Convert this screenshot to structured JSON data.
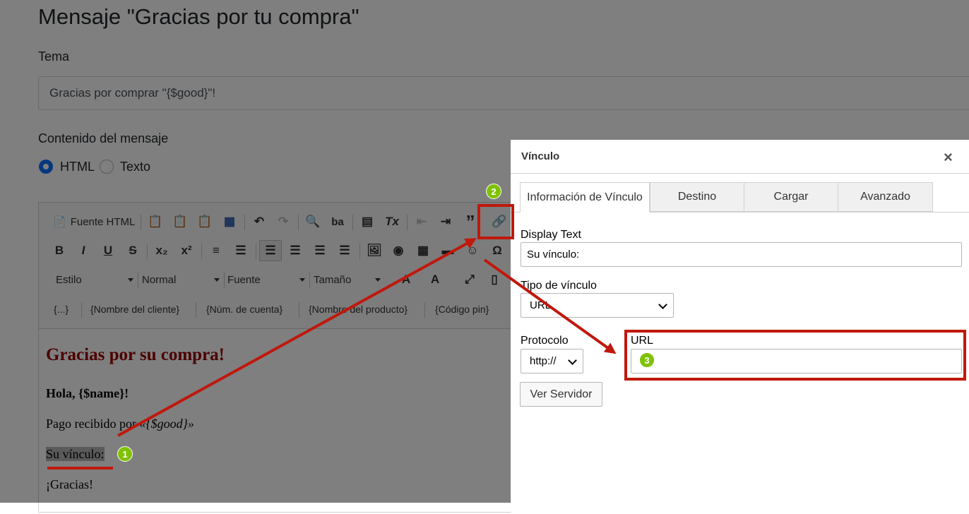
{
  "page": {
    "title": "Mensaje \"Gracias por tu compra\"",
    "subject_label": "Tema",
    "subject_value": "Gracias por comprar \"{$good}\"!",
    "content_label": "Contenido del mensaje",
    "format_options": [
      "HTML",
      "Texto"
    ],
    "format_selected": "HTML"
  },
  "toolbar": {
    "source_label": "Fuente HTML",
    "style_combo": "Estilo",
    "format_combo": "Normal",
    "font_combo": "Fuente",
    "size_combo": "Tamaño",
    "placeholders": [
      "{...}",
      "{Nombre del cliente}",
      "{Núm. de cuenta}",
      "{Nombre del producto}",
      "{Código pin}"
    ]
  },
  "content": {
    "heading": "Gracias por su compra!",
    "greeting": "Hola, {$name}!",
    "payment_prefix": "Pago recibido por ",
    "payment_good": "«{$good}»",
    "link_text": "Su vínculo:",
    "thanks": "¡Gracias!"
  },
  "dialog": {
    "title": "Vínculo",
    "close": "×",
    "tabs": [
      "Información de Vínculo",
      "Destino",
      "Cargar",
      "Avanzado"
    ],
    "active_tab": "Información de Vínculo",
    "display_text_label": "Display Text",
    "display_text_value": "Su vínculo:",
    "link_type_label": "Tipo de vínculo",
    "link_type_value": "URL",
    "protocol_label": "Protocolo",
    "protocol_value": "http://",
    "url_label": "URL",
    "url_value": "",
    "browse_button": "Ver Servidor"
  },
  "annotations": {
    "badges": [
      "1",
      "2",
      "3"
    ],
    "highlight_color": "#c0180c",
    "badge_color": "#7ec200"
  }
}
